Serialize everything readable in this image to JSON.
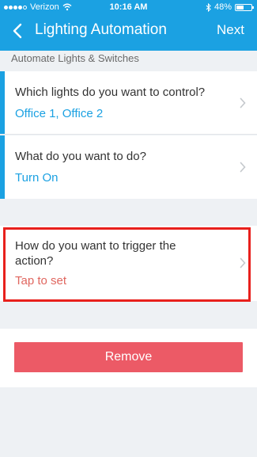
{
  "status_bar": {
    "carrier": "Verizon",
    "time": "10:16 AM",
    "battery": "48%",
    "battery_level": 0.48
  },
  "nav": {
    "title": "Lighting Automation",
    "next": "Next"
  },
  "section_label": "Automate Lights & Switches",
  "rows": [
    {
      "question": "Which lights do you want to control?",
      "answer": "Office 1, Office 2"
    },
    {
      "question": "What do you want to do?",
      "answer": "Turn On"
    },
    {
      "question_line1": "How do you want to trigger the",
      "question_line2": "action?",
      "answer": "Tap to set"
    }
  ],
  "remove_label": "Remove",
  "colors": {
    "accent": "#1ba1e2",
    "remove": "#ec5a66",
    "warning": "#e0665f",
    "highlight_box": "#e8201c"
  }
}
